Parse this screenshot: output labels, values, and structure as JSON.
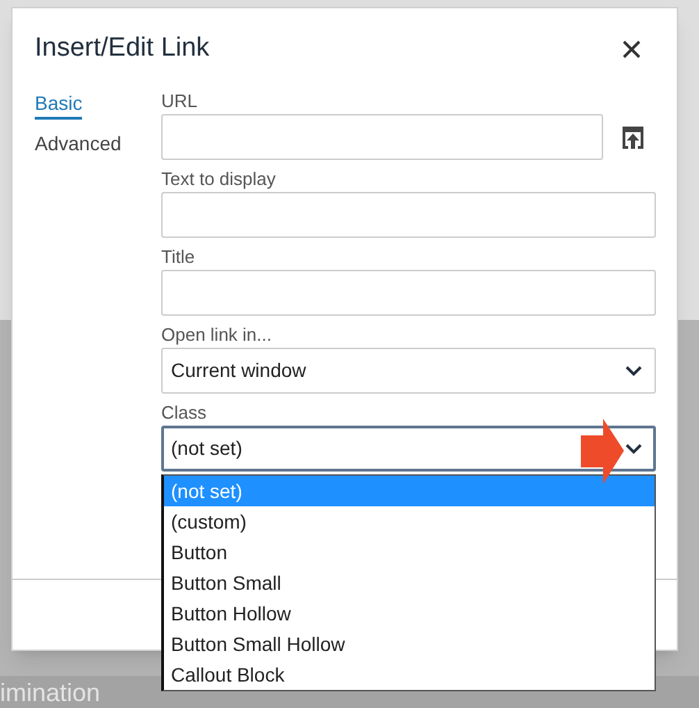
{
  "dialog": {
    "title": "Insert/Edit Link",
    "tabs": [
      {
        "label": "Basic",
        "selected": true
      },
      {
        "label": "Advanced",
        "selected": false
      }
    ],
    "fields": [
      {
        "kind": "url",
        "label": "URL"
      },
      {
        "kind": "text",
        "label": "Text to display"
      },
      {
        "kind": "text",
        "label": "Title"
      },
      {
        "kind": "select",
        "label": "Open link in...",
        "value": "Current window",
        "focused": false
      },
      {
        "kind": "select",
        "label": "Class",
        "value": "(not set)",
        "focused": true
      }
    ],
    "dropdown": {
      "options": [
        {
          "label": "(not set)",
          "selected": true
        },
        {
          "label": "(custom)",
          "selected": false
        },
        {
          "label": "Button",
          "selected": false
        },
        {
          "label": "Button Small",
          "selected": false
        },
        {
          "label": "Button Hollow",
          "selected": false
        },
        {
          "label": "Button Small Hollow",
          "selected": false
        },
        {
          "label": "Callout Block",
          "selected": false
        }
      ]
    }
  },
  "background": {
    "footer_text": "imination"
  }
}
